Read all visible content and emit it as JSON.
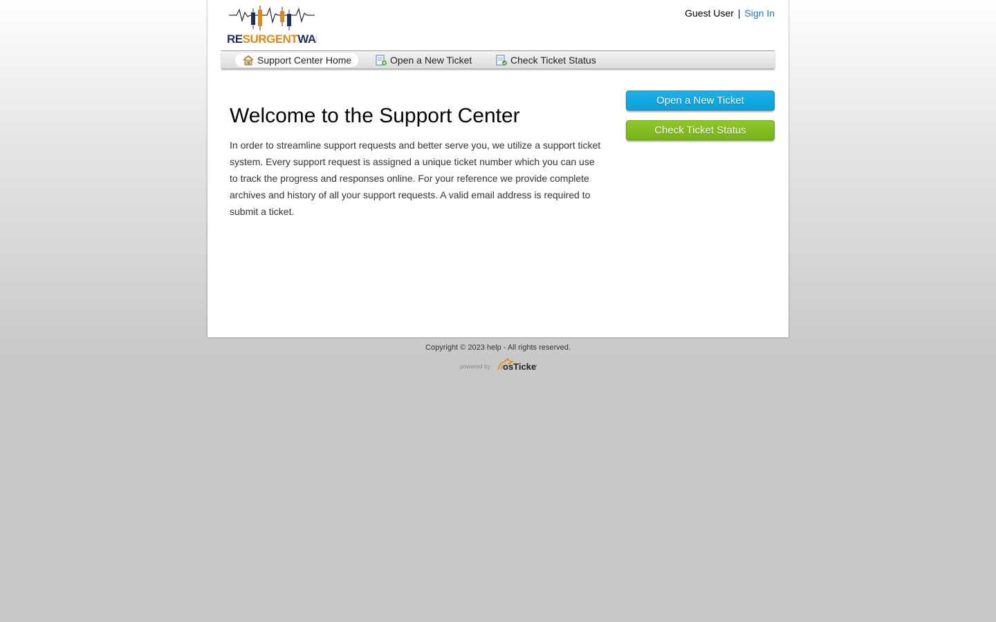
{
  "brand": {
    "logo_text_re": "RE",
    "logo_text_surgent": "SURGENT",
    "logo_text_ware": "WARE"
  },
  "userbar": {
    "user": "Guest User",
    "separator": "|",
    "signin_label": "Sign In"
  },
  "nav": {
    "items": [
      {
        "label": "Support Center Home",
        "icon": "home-icon"
      },
      {
        "label": "Open a New Ticket",
        "icon": "new-ticket-icon"
      },
      {
        "label": "Check Ticket Status",
        "icon": "ticket-status-icon"
      }
    ]
  },
  "main": {
    "title": "Welcome to the Support Center",
    "body": "In order to streamline support requests and better serve you, we utilize a support ticket system. Every support request is assigned a unique ticket number which you can use to track the progress and responses online. For your reference we provide complete archives and history of all your support requests. A valid email address is required to submit a ticket."
  },
  "sidebar": {
    "open_ticket_label": "Open a New Ticket",
    "check_status_label": "Check Ticket Status"
  },
  "footer": {
    "copyright": "Copyright © 2023 help - All rights reserved.",
    "powered_by": "powered by",
    "powered_brand": "osTicket"
  },
  "colors": {
    "link": "#1a7bbd",
    "btn_blue": "#1ab2ea",
    "btn_green": "#8ec82a",
    "logo_orange": "#d98a1a",
    "logo_navy": "#1f2f5a"
  }
}
